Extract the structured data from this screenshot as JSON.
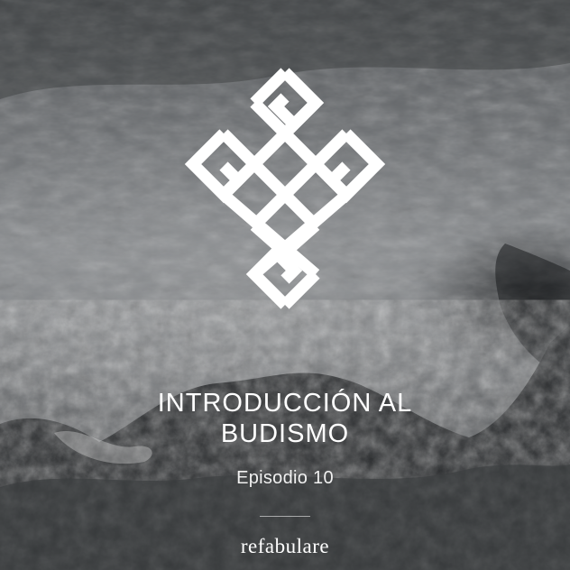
{
  "cover": {
    "title_line1": "INTRODUCCIÓN AL",
    "title_line2": "BUDISMO",
    "episode": "Episodio 10",
    "brand": "refabulare"
  },
  "logo": {
    "icon": "endless-knot-icon",
    "color": "#ffffff"
  }
}
